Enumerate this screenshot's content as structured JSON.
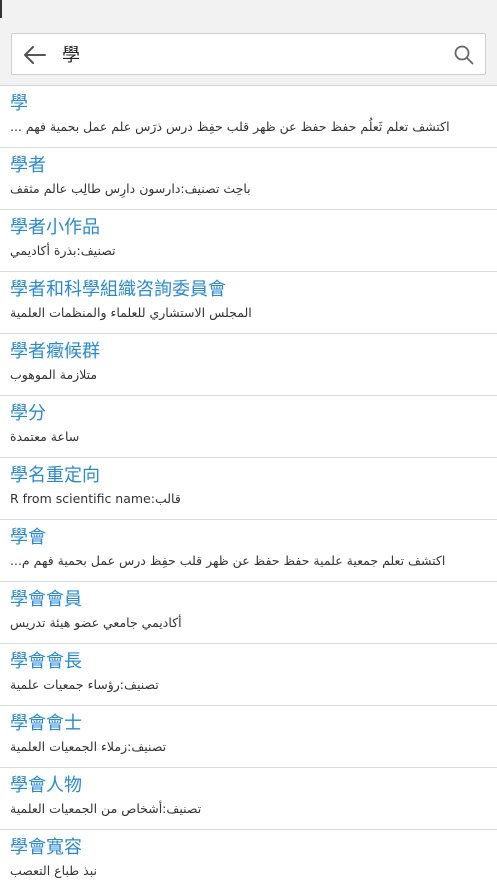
{
  "search": {
    "query": "學",
    "back_icon": "arrow-left-icon",
    "search_icon": "search-icon"
  },
  "results": [
    {
      "term": "學",
      "gloss": "اكتشف تعلم ثَعلُم حفظ حفظ عن ظهر قلب حفِظ درس ذرَس علم عمل بحمية فهم ..."
    },
    {
      "term": "學者",
      "gloss": "باحِث تصنيف:دارسون دارِس طالِب عالم مثقف"
    },
    {
      "term": "學者小作品",
      "gloss": "تصنيف:بذرة أكاديمي"
    },
    {
      "term": "學者和科學組織咨詢委員會",
      "gloss": "المجلس الاستشاري للعلماء والمنظمات العلمية"
    },
    {
      "term": "學者癥候群",
      "gloss": "متلازمة الموهوب"
    },
    {
      "term": "學分",
      "gloss": "ساعة معتمدة"
    },
    {
      "term": "學名重定向",
      "gloss": "R from scientific name:قالب"
    },
    {
      "term": "學會",
      "gloss": "اكتشف تعلم جمعية علمية حفظ حفظ عن ظهر قلب حفِظ درس عمل بحمية فهم م..."
    },
    {
      "term": "學會會員",
      "gloss": "أكاديمي جامعي عضو هيئة تدريس"
    },
    {
      "term": "學會會長",
      "gloss": "تصنيف:رؤساء جمعيات علمية"
    },
    {
      "term": "學會會士",
      "gloss": "تصنيف:زملاء الجمعيات العلمية"
    },
    {
      "term": "學會人物",
      "gloss": "تصنيف:أشخاص من الجمعيات العلمية"
    },
    {
      "term": "學會寬容",
      "gloss": "نبذ طباع التعصب"
    }
  ]
}
